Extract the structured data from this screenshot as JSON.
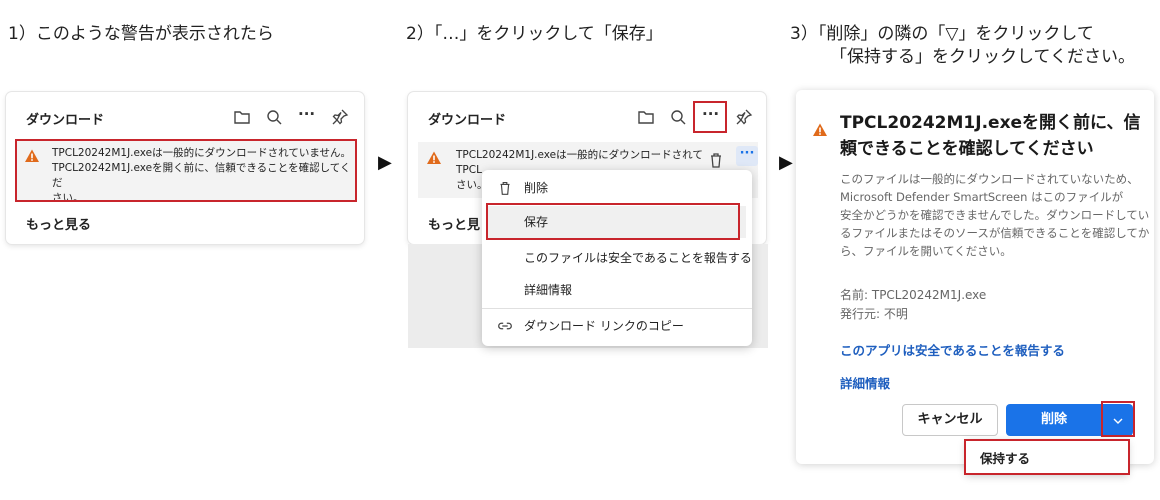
{
  "steps": {
    "step1": "1）このような警告が表示されたら",
    "step2": "2）「…」をクリックして「保存」",
    "step3_line1": "3）「削除」の隣の「▽」をクリックして",
    "step3_line2": "「保持する」をクリックしてください。"
  },
  "arrow": "▶",
  "panel": {
    "title": "ダウンロード",
    "more_glyph": "···",
    "warning_text_1": "TPCL20242M1J.exeは一般的にダウンロードされていません。",
    "warning_text_2": "TPCL20242M1J.exeを開く前に、信頼できることを確認してくだ",
    "warning_text_3": "さい。",
    "more_link": "もっと見る"
  },
  "panel2": {
    "title": "ダウンロード",
    "warning_text_1": "TPCL20242M1J.exeは一般的にダウンロードされて",
    "warning_text_2": "TPCL",
    "warning_text_3": "さい。",
    "more_link": "もっと見",
    "mini_more": "···"
  },
  "context_menu": {
    "items": [
      {
        "label": "削除",
        "icon": "trash-icon"
      },
      {
        "label": "保存",
        "icon": ""
      },
      {
        "label": "このファイルは安全であることを報告する",
        "icon": ""
      },
      {
        "label": "詳細情報",
        "icon": ""
      },
      {
        "label": "ダウンロード リンクのコピー",
        "icon": "link-icon"
      }
    ]
  },
  "dialog": {
    "title_1": "TPCL20242M1J.exeを開く前に、信",
    "title_2": "頼できることを確認してください",
    "body": [
      "このファイルは一般的にダウンロードされていないため、",
      "Microsoft Defender SmartScreen はこのファイルが",
      "安全かどうかを確認できませんでした。ダウンロードしてい",
      "るファイルまたはそのソースが信頼できることを確認してか",
      "ら、ファイルを開いてください。"
    ],
    "name_line": "名前: TPCL20242M1J.exe",
    "publisher_line": "発行元: 不明",
    "report_link": "このアプリは安全であることを報告する",
    "details_link": "詳細情報",
    "cancel_label": "キャンセル",
    "delete_label": "削除",
    "keep_label": "保持する"
  },
  "colors": {
    "accent_blue": "#1a73e8",
    "warning_orange": "#e06a1b",
    "highlight_red": "#c8252c",
    "link_blue": "#1f5fbf"
  }
}
